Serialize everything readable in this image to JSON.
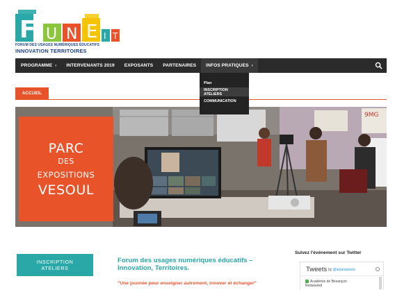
{
  "logo": {
    "letters": [
      "F",
      "U",
      "N",
      "E",
      "I",
      "T"
    ],
    "tagline_top": "FORUM DES USAGES NUMÉRIQUES ÉDUCATIFS",
    "tagline_bottom": "INNOVATION  TERRITOIRES"
  },
  "nav": {
    "items": [
      {
        "label": "PROGRAMME",
        "chevron": "›"
      },
      {
        "label": "INTERVENANTS 2019"
      },
      {
        "label": "EXPOSANTS"
      },
      {
        "label": "PARTENAIRES"
      },
      {
        "label": "INFOS PRATIQUES",
        "chevron": "›"
      }
    ],
    "search_icon": "search-icon"
  },
  "dropdown": {
    "items": [
      "Plan",
      "INSCRIPTION ATELIERS",
      "COMMUNICATION"
    ]
  },
  "breadcrumb": "ACCUEIL",
  "hero": {
    "poster": [
      "PARC",
      "DES",
      "EXPOSITIONS",
      "VESOUL"
    ]
  },
  "content": {
    "inscription_button": [
      "INSCRIPTION",
      "ATELIERS"
    ],
    "title": "Forum des usages numériques éducatifs – Innovation, Territoires.",
    "quote": "\"Une journée pour enseigner autrement, innover et échanger\""
  },
  "twitter": {
    "heading": "Suivez l'événement sur Twitter",
    "box_title": "Tweets",
    "by": "by",
    "handle": "@acbesancon",
    "entry_name": "Académie de Besançon",
    "entry_sub": "Retweeted"
  },
  "colors": {
    "orange": "#e8532a",
    "teal": "#2aa8a8",
    "navbar": "#2b2b2b",
    "logo_blue": "#1b3f8b"
  }
}
